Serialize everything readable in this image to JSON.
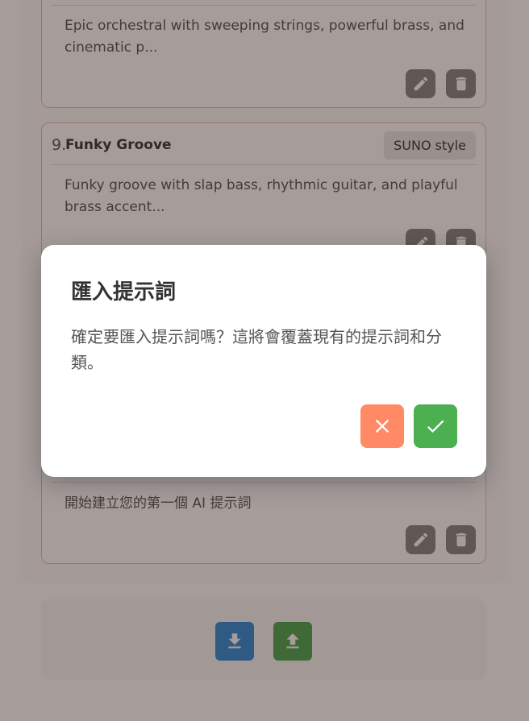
{
  "cards": [
    {
      "description": "Epic orchestral with sweeping strings, powerful brass, and cinematic p..."
    },
    {
      "number": "9.",
      "title": "Funky Groove",
      "tag": "SUNO style",
      "description": "Funky groove with slap bass, rhythmic guitar, and playful brass accent..."
    },
    {
      "description": "開始建立您的第一個 AI 提示詞"
    }
  ],
  "icons": {
    "edit": "pencil-icon",
    "delete": "trash-icon",
    "export": "download-icon",
    "import": "upload-icon",
    "cancel": "close-icon",
    "confirm": "check-icon"
  },
  "colors": {
    "card_border": "#e8b49a",
    "action_button": "#7a7a7a",
    "export_button": "#1a7fd4",
    "import_button": "#3b9b3f",
    "cancel_button": "#ff8a65",
    "confirm_button": "#4caf50"
  },
  "dialog": {
    "title": "匯入提示詞",
    "message": "確定要匯入提示詞嗎？這將會覆蓋現有的提示詞和分類。"
  }
}
